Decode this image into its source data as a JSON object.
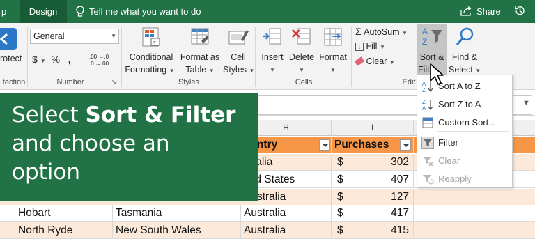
{
  "tabs": {
    "partial": "p",
    "design": "Design"
  },
  "tellme": "Tell me what you want to do",
  "share": "Share",
  "ribbon": {
    "protect": {
      "line1": "rotect",
      "line2": "tection"
    },
    "number": {
      "format_value": "General",
      "currency": "$",
      "percent": "%",
      "comma": ",",
      "inc_decimal": ".00 →.0",
      "dec_decimal": ".0 →.00",
      "group_label": "Number"
    },
    "styles": {
      "conditional": [
        "Conditional",
        "Formatting"
      ],
      "format_table": [
        "Format as",
        "Table"
      ],
      "cell_styles": [
        "Cell",
        "Styles"
      ],
      "group_label": "Styles"
    },
    "cells": {
      "insert": "Insert",
      "delete": "Delete",
      "format": "Format",
      "group_label": "Cells"
    },
    "editing": {
      "autosum": "AutoSum",
      "fill": "Fill",
      "clear": "Clear",
      "sort_filter": [
        "Sort &",
        "Filt"
      ],
      "find_select": [
        "Find &",
        "Select"
      ],
      "group_label": "Edit"
    }
  },
  "sort_menu": {
    "items": [
      {
        "label": "Sort A to Z",
        "icon": "sort-a-to-z-icon",
        "enabled": true
      },
      {
        "label": "Sort Z to A",
        "icon": "sort-z-to-a-icon",
        "enabled": true
      },
      {
        "label": "Custom Sort...",
        "icon": "custom-sort-icon",
        "enabled": true
      },
      {
        "label": "Filter",
        "icon": "filter-icon",
        "enabled": true
      },
      {
        "label": "Clear",
        "icon": "clear-filter-icon",
        "enabled": false
      },
      {
        "label": "Reapply",
        "icon": "reapply-icon",
        "enabled": false
      }
    ]
  },
  "grid": {
    "columns": {
      "H": "H",
      "I": "I"
    },
    "header": {
      "country": "ountry",
      "purchases": "Purchases"
    },
    "rows": [
      {
        "city": "",
        "state": "",
        "country": "stralia",
        "currency": "$",
        "amount": "302"
      },
      {
        "city": "",
        "state": "",
        "country": "ited States",
        "currency": "$",
        "amount": "407"
      },
      {
        "city": "",
        "state": "",
        "country": "Australia",
        "currency": "$",
        "amount": "127"
      },
      {
        "city": "Hobart",
        "state": "Tasmania",
        "country": "Australia",
        "currency": "$",
        "amount": "417"
      },
      {
        "city": "North Ryde",
        "state": "New South Wales",
        "country": "Australia",
        "currency": "$",
        "amount": "415"
      }
    ]
  },
  "callout": {
    "pre": "Select ",
    "bold": "Sort & Filter",
    "rest1": "and choose an",
    "rest2": "option"
  },
  "colors": {
    "excel_green": "#217346",
    "header_fill": "#f79646",
    "band_fill": "#fde9d9"
  }
}
